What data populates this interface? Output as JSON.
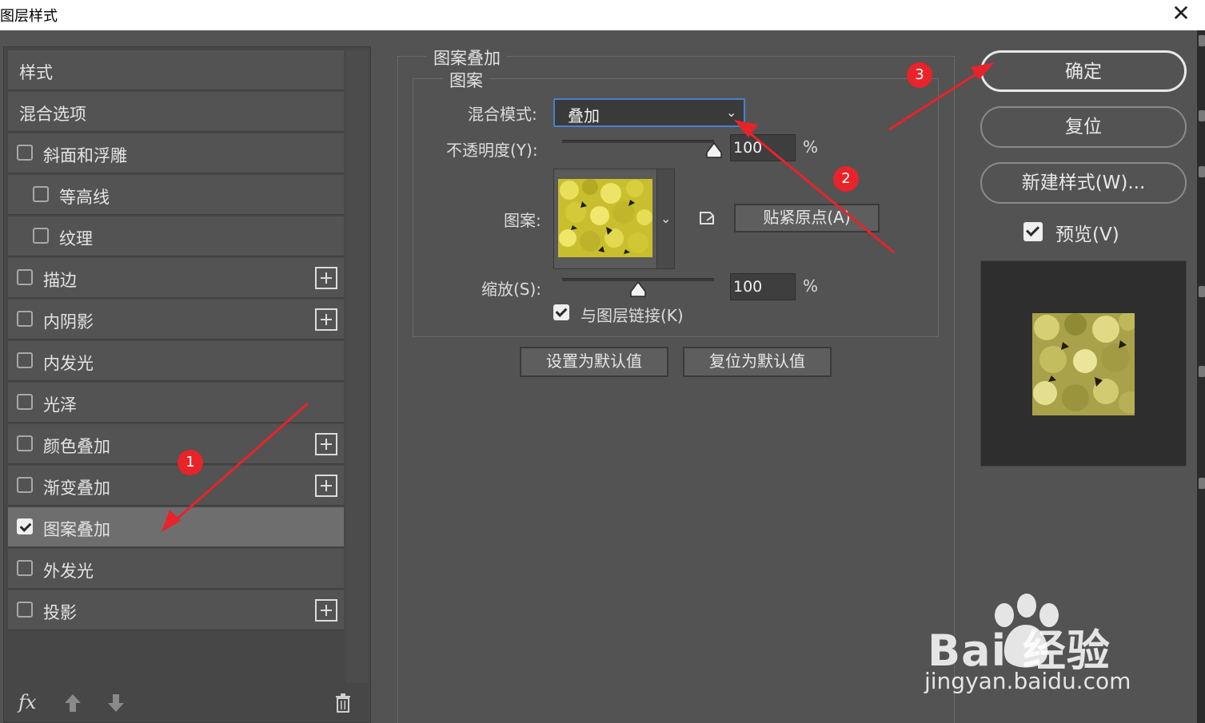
{
  "window": {
    "title": "图层样式",
    "close_glyph": "✕"
  },
  "sidebar": {
    "items": [
      {
        "label": "样式",
        "checkbox": false,
        "checked": false,
        "plus": false,
        "indent": false
      },
      {
        "label": "混合选项",
        "checkbox": false,
        "checked": false,
        "plus": false,
        "indent": false
      },
      {
        "label": "斜面和浮雕",
        "checkbox": true,
        "checked": false,
        "plus": false,
        "indent": false
      },
      {
        "label": "等高线",
        "checkbox": true,
        "checked": false,
        "plus": false,
        "indent": true
      },
      {
        "label": "纹理",
        "checkbox": true,
        "checked": false,
        "plus": false,
        "indent": true
      },
      {
        "label": "描边",
        "checkbox": true,
        "checked": false,
        "plus": true,
        "indent": false
      },
      {
        "label": "内阴影",
        "checkbox": true,
        "checked": false,
        "plus": true,
        "indent": false
      },
      {
        "label": "内发光",
        "checkbox": true,
        "checked": false,
        "plus": false,
        "indent": false
      },
      {
        "label": "光泽",
        "checkbox": true,
        "checked": false,
        "plus": false,
        "indent": false
      },
      {
        "label": "颜色叠加",
        "checkbox": true,
        "checked": false,
        "plus": true,
        "indent": false
      },
      {
        "label": "渐变叠加",
        "checkbox": true,
        "checked": false,
        "plus": true,
        "indent": false
      },
      {
        "label": "图案叠加",
        "checkbox": true,
        "checked": true,
        "plus": false,
        "indent": false,
        "active": true
      },
      {
        "label": "外发光",
        "checkbox": true,
        "checked": false,
        "plus": false,
        "indent": false
      },
      {
        "label": "投影",
        "checkbox": true,
        "checked": false,
        "plus": true,
        "indent": false
      }
    ],
    "footer": {
      "fx": "fx",
      "icons": [
        "arrow-up-icon",
        "arrow-down-icon",
        "trash-icon"
      ]
    }
  },
  "panel": {
    "group_title": "图案叠加",
    "subgroup_title": "图案",
    "blend_mode_label": "混合模式:",
    "blend_mode_value": "叠加",
    "opacity_label": "不透明度(Y):",
    "opacity_value": "100",
    "opacity_level": 100,
    "pct": "%",
    "pattern_label": "图案:",
    "snap_button": "贴紧原点(A)",
    "scale_label": "缩放(S):",
    "scale_value": "100",
    "scale_level": 100,
    "link_label": "与图层链接(K)",
    "link_checked": true,
    "set_default": "设置为默认值",
    "reset_default": "复位为默认值"
  },
  "actions": {
    "ok": "确定",
    "reset": "复位",
    "new_style": "新建样式(W)...",
    "preview_label": "预览(V)",
    "preview_checked": true
  },
  "annotations": {
    "badges": [
      "1",
      "2",
      "3"
    ],
    "color": "#e8232a"
  },
  "watermark": {
    "logo_text": "Bai  经验",
    "url": "jingyan.baidu.com"
  },
  "colors": {
    "panel_bg": "#535353",
    "focus": "#4a7fd0",
    "pattern_yellow": "#d9d23a"
  }
}
